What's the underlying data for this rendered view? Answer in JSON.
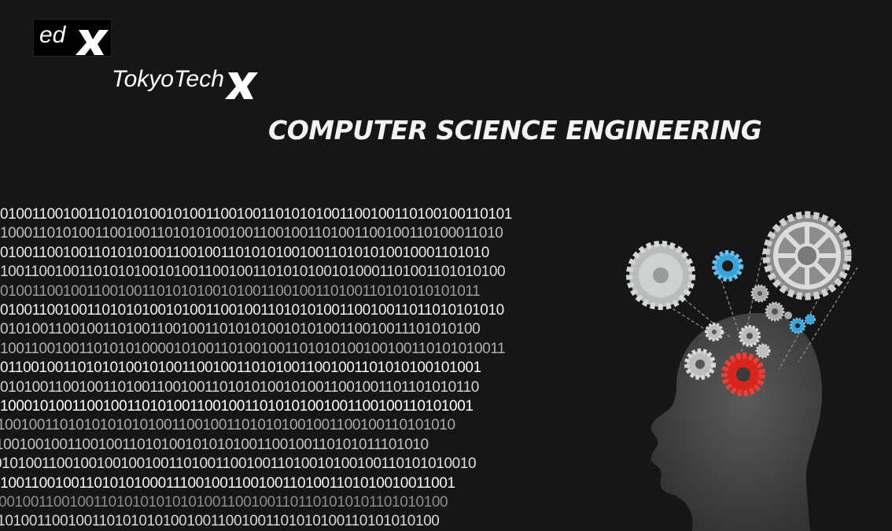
{
  "logos": {
    "edx": {
      "text": "edX"
    },
    "tokyotech": {
      "text": "TokyoTechX"
    }
  },
  "title": "COMPUTER SCIENCE ENGINEERING",
  "binary_rows": [
    "01001100100110101010010100110010011010101001100100110100100110101",
    "1000110101001100100110101010010011001001101001100100110100011010",
    "01001100100110101010011001001101010100100110101010010001101010",
    "1001100100110101010010100110010011010101001010001101001101010100",
    "0100110010011001001101010100101001100100110100110101010101011",
    "0100110010011010101001010011001001101010100110010011011010101010",
    "0101001100100110100110010011010101001010100110010011101010100",
    "1001100100110101010000101001101001001101010100100100110101010011",
    "0110010011010101001010011001001101010011001001101010100101001",
    "0101001100100110100110010011010101001010011001001101101010110",
    "100010100110010011010100110010011010101001001100100110101001",
    "1001001101010101010100110010011010101001001100100110101010",
    "1001001001100100110101001010101001100100110101011101010",
    "0101001100100100100100110100110010011010010100100110101010010",
    "01001100100110101010001110010011001001101001101010010011001",
    "1001001100100110101010101010011001001101101010101101010100",
    "010100110010011010101010010011001001101010100110101010100"
  ],
  "colors": {
    "background": "#161616",
    "title_text": "#f2f2f2",
    "head_silhouette": "#4a4a4a",
    "red_gear": "#d4261f",
    "blue_gear": "#39a3d8",
    "grey_gear": "#b9b9b9"
  },
  "icons": [
    "edx-logo",
    "tokyotechx-logo",
    "head-silhouette-icon",
    "gear-icon"
  ]
}
